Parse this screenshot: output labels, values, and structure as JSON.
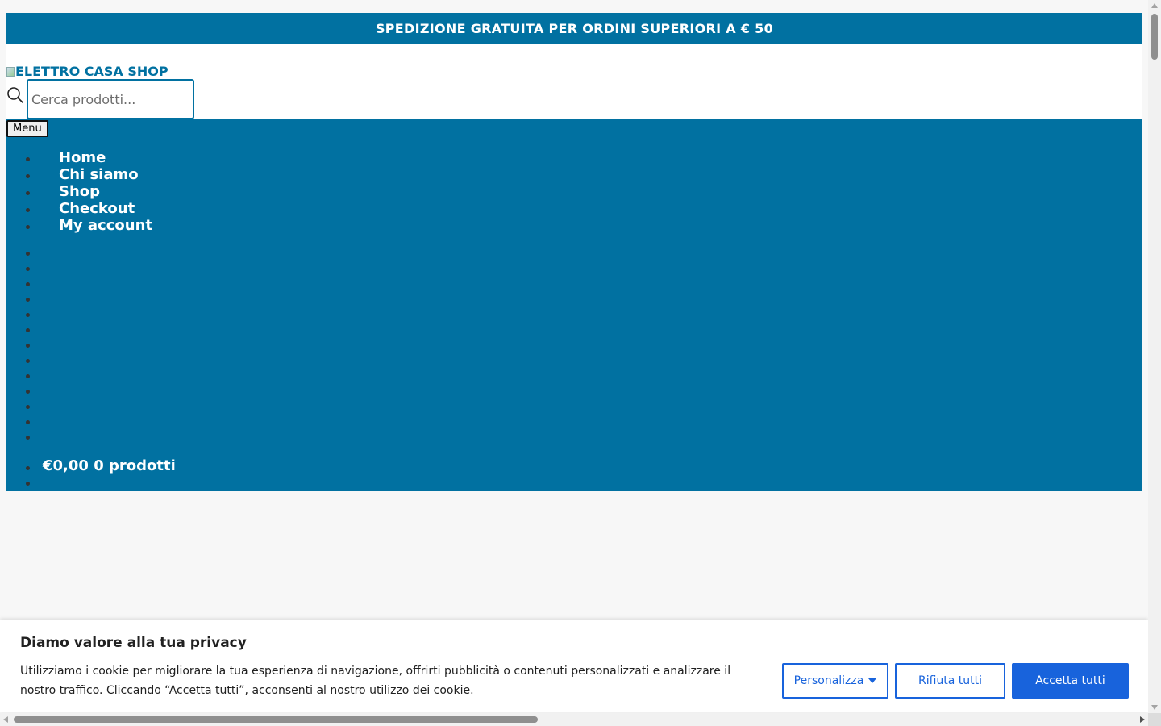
{
  "topbar": {
    "text": "SPEDIZIONE GRATUITA PER ORDINI SUPERIORI A € 50"
  },
  "header": {
    "logo_alt": "ELETTRO CASA SHOP",
    "search_placeholder": "Cerca prodotti...",
    "search_value": ""
  },
  "nav": {
    "menu_label": "Menu",
    "items": [
      {
        "label": "Home"
      },
      {
        "label": "Chi siamo"
      },
      {
        "label": "Shop"
      },
      {
        "label": "Checkout"
      },
      {
        "label": "My account"
      }
    ]
  },
  "cart": {
    "total": "€0,00",
    "count_label": "0 prodotti"
  },
  "cookie": {
    "title": "Diamo valore alla tua privacy",
    "text": "Utilizziamo i cookie per migliorare la tua esperienza di navigazione, offrirti pubblicità o contenuti personalizzati e analizzare il nostro traffico. Cliccando “Accetta tutti”, acconsenti al nostro utilizzo dei cookie.",
    "customize_label": "Personalizza",
    "reject_label": "Rifiuta tutti",
    "accept_label": "Accetta tutti"
  },
  "colors": {
    "brand": "#0171a1",
    "cookie_accent": "#1863dc",
    "page_bg": "#f7f7f7"
  },
  "icons": {
    "search": "search-icon",
    "customize_caret": "caret-down-icon"
  }
}
